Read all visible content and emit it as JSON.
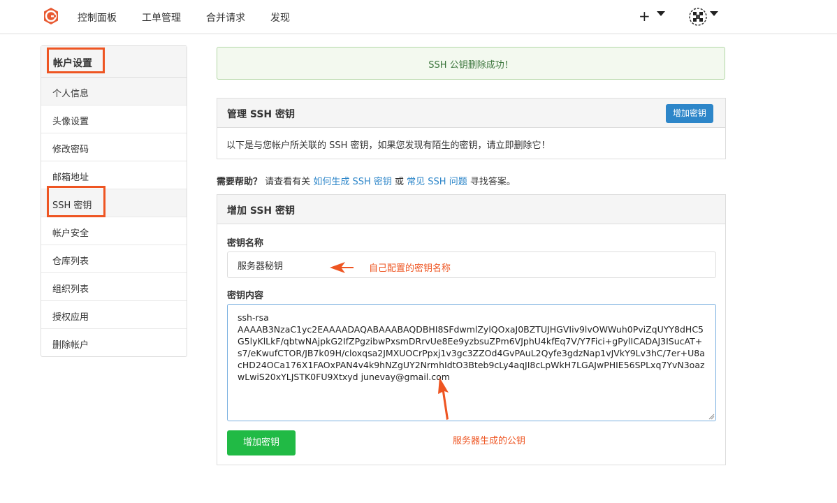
{
  "nav": {
    "items": [
      "控制面板",
      "工单管理",
      "合并请求",
      "发现"
    ],
    "plus": "+"
  },
  "sidebar": {
    "header": "帐户设置",
    "items": [
      "个人信息",
      "头像设置",
      "修改密码",
      "邮箱地址",
      "SSH 密钥",
      "帐户安全",
      "仓库列表",
      "组织列表",
      "授权应用",
      "删除帐户"
    ],
    "active_index": 4
  },
  "alert": {
    "message": "SSH 公钥删除成功！"
  },
  "manage_panel": {
    "title": "管理 SSH 密钥",
    "add_button": "增加密钥",
    "description": "以下是与您帐户所关联的 SSH 密钥，如果您发现有陌生的密钥，请立即删除它！"
  },
  "help": {
    "label": "需要帮助？",
    "text_before": "请查看有关",
    "link1": "如何生成 SSH 密钥",
    "text_or": "或",
    "link2": "常见 SSH 问题",
    "text_after": "寻找答案。"
  },
  "add_panel": {
    "title": "增加 SSH 密钥",
    "name_label": "密钥名称",
    "name_value": "服务器秘钥",
    "content_label": "密钥内容",
    "content_value": "ssh-rsa\nAAAAB3NzaC1yc2EAAAADAQABAAABAQDBHI8SFdwmlZylQOxaJ0BZTUJHGVIiv9lvOWWuh0PviZqUYY8dHC5G5lyKlLkF/qbtwNAjpkG2IfZPgzibwPxsmDRrvUe8Ee9yzbsuZPm6VJphU4kfEq7V/Y7Fici+gPylICADAJ3ISucAT+s7/eKwufCTOR/JB7k09H/cloxqsa2JMXUOCrPpxj1v3gc3ZZOd4GvPAuL2Qyfe3gdzNap1vJVkY9Lv3hC/7er+U8acHD24OCa176X1FAOxPAN4v4k9hNZgUY2NrmhIdtO3Bteb9cLy4aqJI8cLpWkH7LGAJwPHIE56SPLxq7YvN3oazwLwiS20xYLJSTK0FU9Xtxyd junevay@gmail.com",
    "submit_button": "增加密钥"
  },
  "annotations": {
    "name_note": "自己配置的密钥名称",
    "key_note": "服务器生成的公钥",
    "color": "#ee5522"
  },
  "colors": {
    "primary_blue": "#2d86c9",
    "success_green": "#21ba45",
    "alert_text": "#3c763d",
    "annotation": "#ee5522"
  }
}
